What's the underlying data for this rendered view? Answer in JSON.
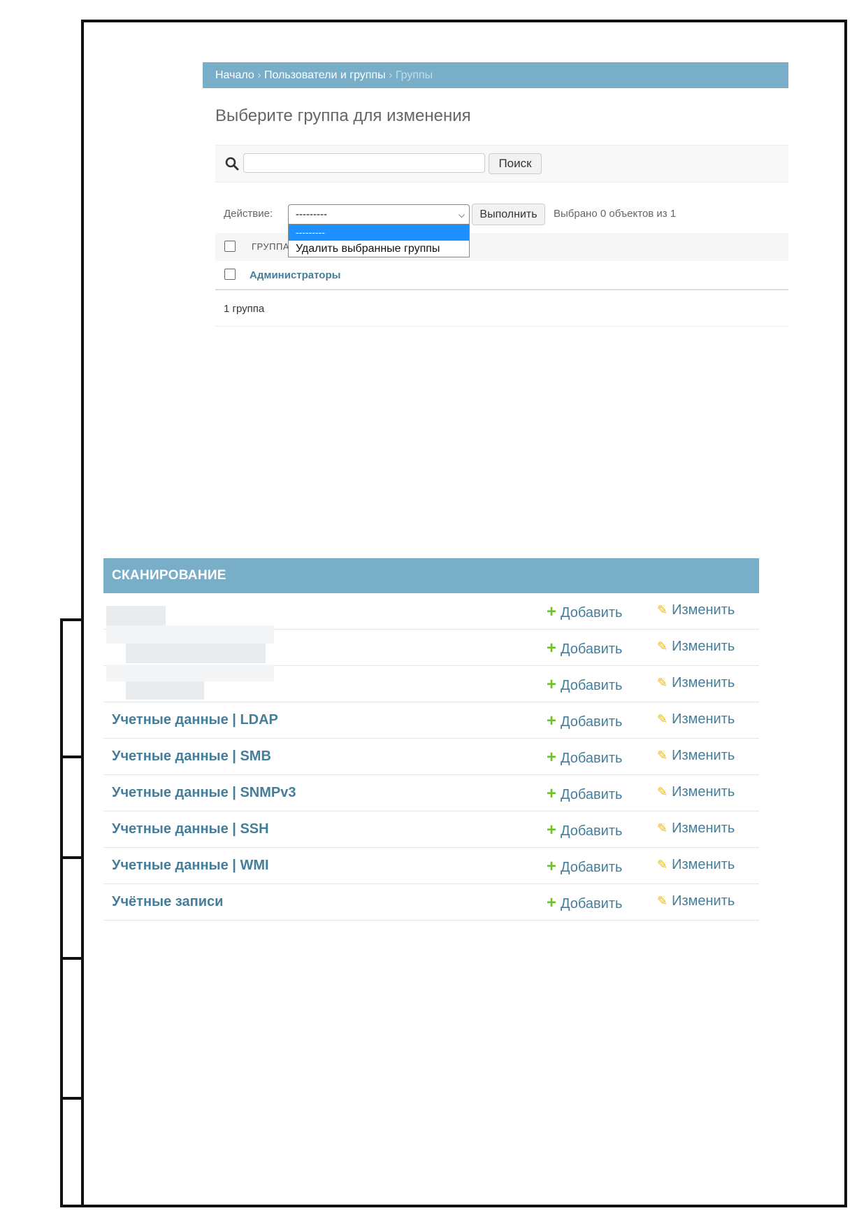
{
  "breadcrumbs": {
    "home": "Начало",
    "section": "Пользователи и группы",
    "current": "Группы",
    "separator": "›"
  },
  "page_title": "Выберите группа для изменения",
  "search": {
    "button_label": "Поиск",
    "value": ""
  },
  "actions": {
    "label": "Действие:",
    "selected_value": "---------",
    "go_label": "Выполнить",
    "selected_count": "Выбрано 0 объектов из 1",
    "options": [
      "---------",
      "Удалить выбранные группы"
    ]
  },
  "table": {
    "column_header": "ГРУППА",
    "rows": [
      {
        "name": "Администраторы"
      }
    ],
    "count": "1 группа"
  },
  "module": {
    "caption": "СКАНИРОВАНИЕ",
    "add_label": "Добавить",
    "change_label": "Изменить",
    "rows": [
      {
        "name": ""
      },
      {
        "name": ""
      },
      {
        "name": ""
      },
      {
        "name": "Учетные данные | LDAP"
      },
      {
        "name": "Учетные данные | SMB"
      },
      {
        "name": "Учетные данные | SNMPv3"
      },
      {
        "name": "Учетные данные | SSH"
      },
      {
        "name": "Учетные данные | WMI"
      },
      {
        "name": "Учётные записи"
      }
    ]
  },
  "colors": {
    "header_bg": "#79aec8",
    "link": "#447e9b",
    "add_icon": "#70bf2b",
    "change_icon": "#efb80b",
    "dropdown_highlight": "#1e90ff"
  }
}
